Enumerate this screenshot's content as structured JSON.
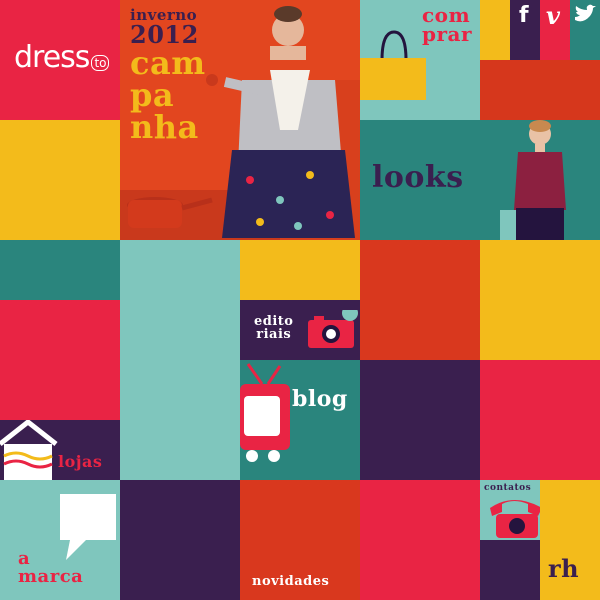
{
  "brand": {
    "name": "dress",
    "suffix": "to"
  },
  "campaign": {
    "line1": "inverno",
    "line2": "2012",
    "line3": "cam",
    "line4": "pa",
    "line5": "nha"
  },
  "nav": {
    "comprar": {
      "line1": "com",
      "line2": "prar"
    },
    "looks": "looks",
    "editoriais": {
      "line1": "edito",
      "line2": "riais"
    },
    "blog": "blog",
    "lojas": "lojas",
    "a_marca": {
      "line1": "a",
      "line2": "marca"
    },
    "novidades": "novidades",
    "contatos": "contatos",
    "rh": "rh"
  },
  "social": {
    "facebook": "f",
    "vimeo": "v"
  },
  "icons": [
    "facebook-icon",
    "vimeo-icon",
    "twitter-icon",
    "shopping-bag-icon",
    "camera-icon",
    "tv-icon",
    "house-icon",
    "speech-bubble-icon",
    "telephone-icon"
  ],
  "colors": {
    "red": "#e92444",
    "yellow": "#f3bb1b",
    "teal": "#2a857d",
    "mint": "#7fc6bd",
    "purple": "#3a1f4f",
    "orange": "#d9381e",
    "dark": "#24143e",
    "white": "#ffffff"
  }
}
